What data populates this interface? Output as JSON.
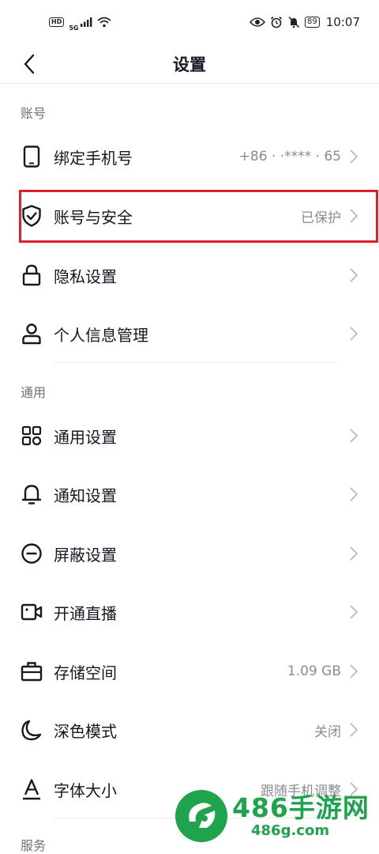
{
  "status_bar": {
    "hd": "HD",
    "network": "5G",
    "battery": "89",
    "time": "10:07"
  },
  "header": {
    "title": "设置"
  },
  "sections": {
    "account": {
      "title": "账号",
      "items": [
        {
          "label": "绑定手机号",
          "value": "+86 ·  ·****  · 65",
          "icon": "phone-icon"
        },
        {
          "label": "账号与安全",
          "value": "已保护",
          "icon": "shield-check-icon"
        },
        {
          "label": "隐私设置",
          "value": "",
          "icon": "lock-icon"
        },
        {
          "label": "个人信息管理",
          "value": "",
          "icon": "user-icon"
        }
      ]
    },
    "general": {
      "title": "通用",
      "items": [
        {
          "label": "通用设置",
          "value": "",
          "icon": "grid-icon"
        },
        {
          "label": "通知设置",
          "value": "",
          "icon": "bell-icon"
        },
        {
          "label": "屏蔽设置",
          "value": "",
          "icon": "block-icon"
        },
        {
          "label": "开通直播",
          "value": "",
          "icon": "video-camera-icon"
        },
        {
          "label": "存储空间",
          "value": "1.09 GB",
          "icon": "briefcase-icon"
        },
        {
          "label": "深色模式",
          "value": "关闭",
          "icon": "moon-icon"
        },
        {
          "label": "字体大小",
          "value": "跟随手机调整",
          "icon": "font-size-icon"
        }
      ]
    },
    "service": {
      "title": "服务"
    }
  },
  "watermark": {
    "title": "486手游网",
    "subtitle": "486g.com"
  },
  "colors": {
    "highlight": "#e01f26",
    "watermark": "#1fa34d",
    "secondary_text": "#8a8b91"
  }
}
